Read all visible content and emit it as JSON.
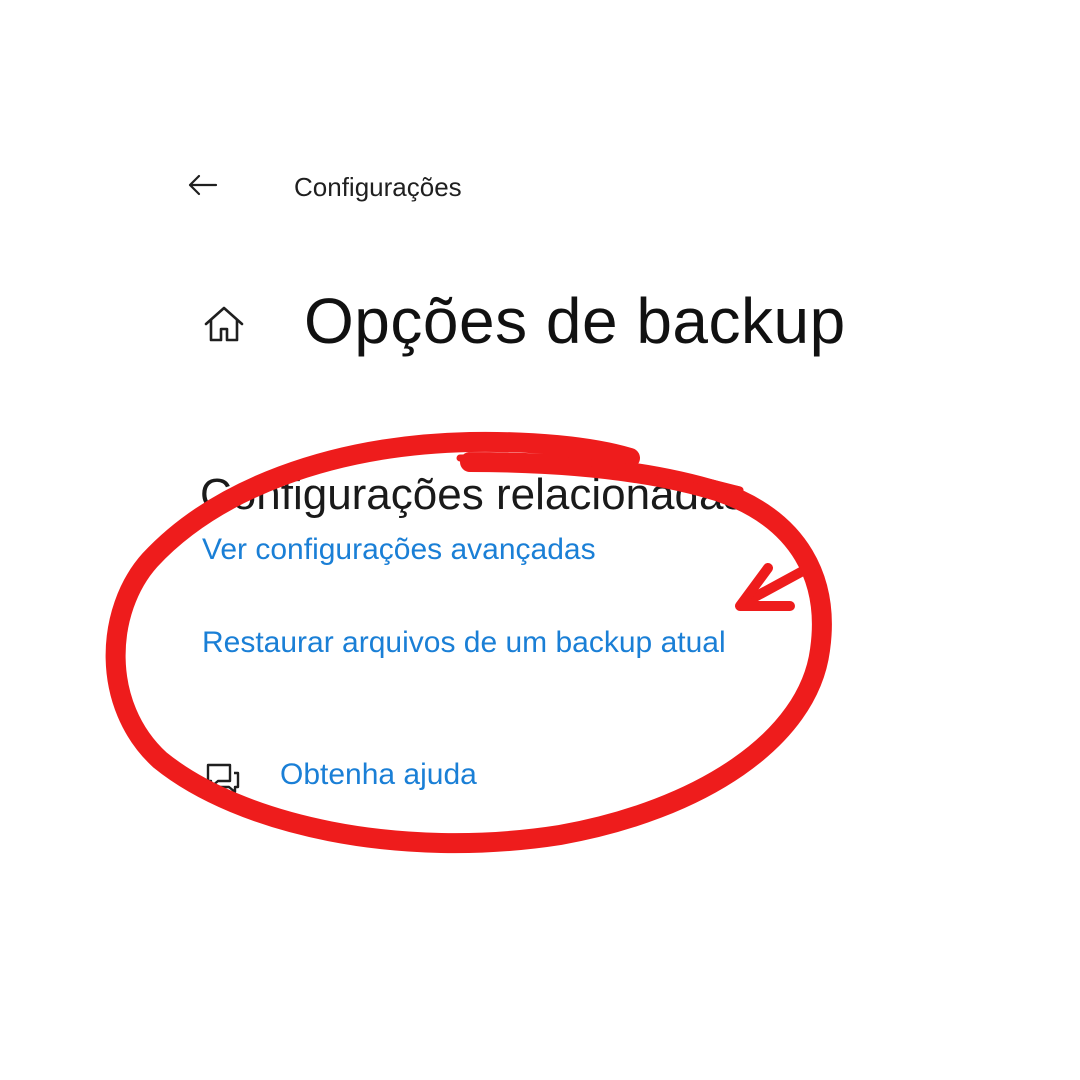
{
  "header": {
    "back_icon": "arrow-left-icon",
    "app_title": "Configurações"
  },
  "page": {
    "home_icon": "home-icon",
    "title": "Opções de backup"
  },
  "related": {
    "heading": "Configurações relacionadas",
    "links": {
      "advanced": "Ver configurações avançadas",
      "restore": "Restaurar arquivos de um backup atual"
    }
  },
  "help": {
    "icon": "help-chat-icon",
    "label": "Obtenha ajuda"
  },
  "colors": {
    "link": "#1a7fd6",
    "annotation": "#ee1c1c"
  }
}
